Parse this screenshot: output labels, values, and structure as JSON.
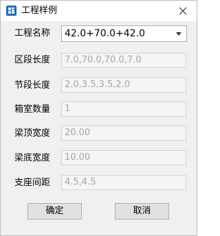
{
  "window": {
    "title": "工程样例",
    "close_glyph": "✕"
  },
  "form": {
    "rows": [
      {
        "label": "工程名称",
        "value": "42.0+70.0+42.0",
        "kind": "select"
      },
      {
        "label": "区段长度",
        "value": "7.0,70.0,70.0,7.0",
        "kind": "disabled-input"
      },
      {
        "label": "节段长度",
        "value": "2.0,3.5,3.5,2.0",
        "kind": "disabled-input"
      },
      {
        "label": "箱室数量",
        "value": "1",
        "kind": "disabled-input"
      },
      {
        "label": "梁顶宽度",
        "value": "20.00",
        "kind": "disabled-input"
      },
      {
        "label": "梁底宽度",
        "value": "10.00",
        "kind": "disabled-input"
      },
      {
        "label": "支座间距",
        "value": "4.5,4.5",
        "kind": "disabled-input"
      }
    ]
  },
  "buttons": {
    "ok_label": "确定",
    "cancel_label": "取消"
  },
  "colors": {
    "icon_accent": "#1a6fc2",
    "disabled_text": "#a6a6a6"
  }
}
